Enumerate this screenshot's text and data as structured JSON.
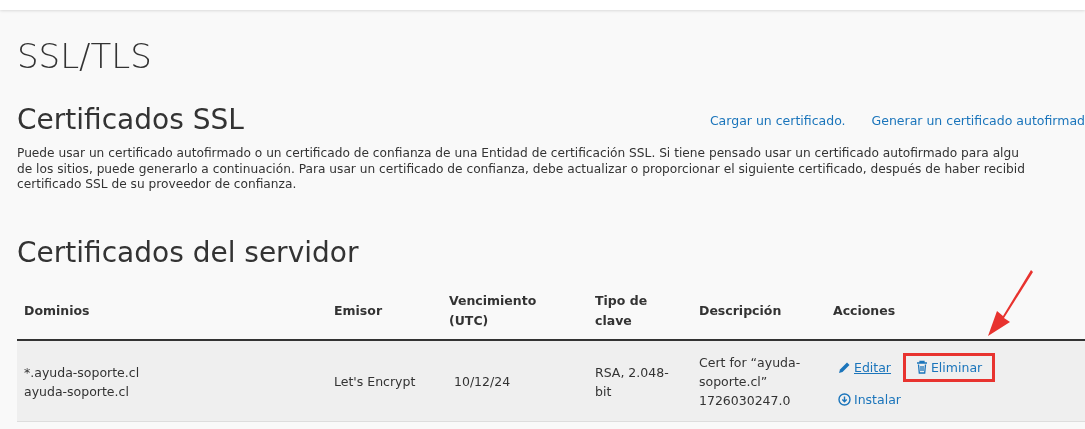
{
  "page_title": "SSL/TLS",
  "ssl_section": {
    "title": "Certificados SSL",
    "links": [
      "Cargar un certificado.",
      "Generar un certificado autofirmad"
    ],
    "description_lines": [
      "Puede usar un certificado autofirmado o un certificado de confianza de una Entidad de certificación SSL. Si tiene pensado usar un certificado autofirmado para algu",
      "de los sitios, puede generarlo a continuación. Para usar un certificado de confianza, debe actualizar o proporcionar el siguiente certificado, después de haber recibid",
      "certificado SSL de su proveedor de confianza."
    ]
  },
  "server_section": {
    "title": "Certificados del servidor",
    "table": {
      "columns": [
        [
          "Dominios"
        ],
        [
          "Emisor"
        ],
        [
          "Vencimiento",
          "(UTC)"
        ],
        [
          "Tipo de",
          "clave"
        ],
        [
          "Descripción"
        ],
        [
          "Acciones"
        ]
      ],
      "rows": [
        {
          "domains": [
            "*.ayuda-soporte.cl",
            "ayuda-soporte.cl"
          ],
          "issuer": "Let's Encrypt",
          "expires": "10/12/24",
          "key_type": [
            "RSA, 2.048-",
            "bit"
          ],
          "description": [
            "Cert for “ayuda-",
            "soporte.cl”",
            "1726030247.0"
          ],
          "actions": [
            {
              "kind": "edit",
              "label": "Editar",
              "highlighted": false
            },
            {
              "kind": "delete",
              "label": "Eliminar",
              "highlighted": true
            },
            {
              "kind": "install",
              "label": "Instalar",
              "highlighted": false
            }
          ]
        }
      ]
    }
  }
}
